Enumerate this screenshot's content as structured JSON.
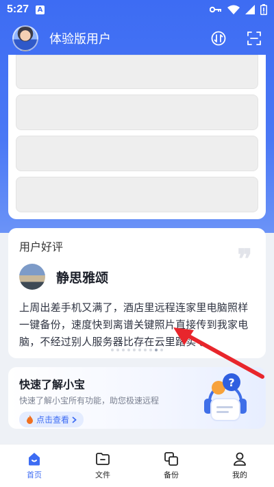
{
  "status_bar": {
    "time": "5:27",
    "notification_icon": "A",
    "icons": [
      "key-icon",
      "wifi-icon",
      "signal-icon",
      "battery-icon"
    ]
  },
  "header": {
    "username": "体验版用户",
    "icons": [
      "transfer-icon",
      "scan-icon"
    ]
  },
  "review": {
    "title": "用户好评",
    "name": "静思雅颂",
    "text": "上周出差手机又满了，酒店里远程连家里电脑照样一键备份，速度快到离谱关键照片直接传到我家电脑，不经过别人服务器比存在云里踏实 。",
    "page_count": 10,
    "active_page": 8
  },
  "quick": {
    "title": "快速了解小宝",
    "subtitle": "快速了解小宝所有功能，助您极速远程",
    "button": "点击查看"
  },
  "nav": [
    {
      "label": "首页",
      "icon": "home-icon",
      "active": true
    },
    {
      "label": "文件",
      "icon": "folder-icon",
      "active": false
    },
    {
      "label": "备份",
      "icon": "backup-icon",
      "active": false
    },
    {
      "label": "我的",
      "icon": "profile-icon",
      "active": false
    }
  ],
  "colors": {
    "accent": "#3d6cf3",
    "annotation_arrow": "#e8262c"
  }
}
